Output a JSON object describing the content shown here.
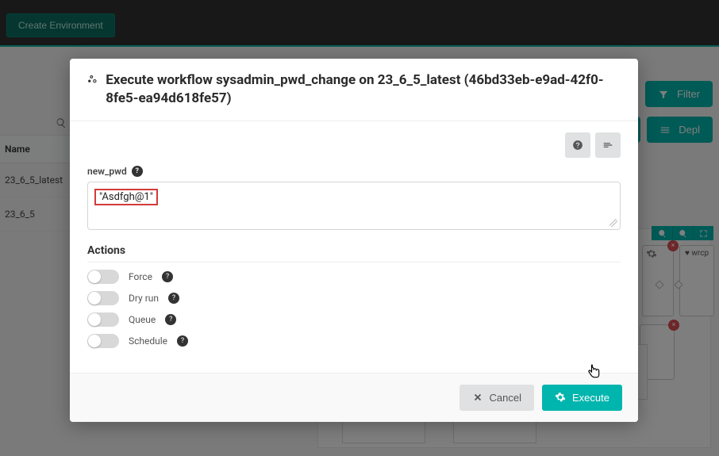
{
  "topbar": {
    "create_env": "Create Environment"
  },
  "right_buttons": {
    "filter": "Filter",
    "depl": "Depl"
  },
  "left_table": {
    "header": "Name",
    "rows": [
      "23_6_5_latest",
      "23_6_5"
    ]
  },
  "canvas": {
    "node_label": "wrcp"
  },
  "modal": {
    "title": "Execute workflow sysadmin_pwd_change on 23_6_5_latest (46bd33eb-e9ad-42f0-8fe5-ea94d618fe57)",
    "field_label": "new_pwd",
    "field_value": "\"Asdfgh@1\"",
    "actions_title": "Actions",
    "toggles": [
      {
        "label": "Force"
      },
      {
        "label": "Dry run"
      },
      {
        "label": "Queue"
      },
      {
        "label": "Schedule"
      }
    ],
    "cancel": "Cancel",
    "execute": "Execute"
  }
}
